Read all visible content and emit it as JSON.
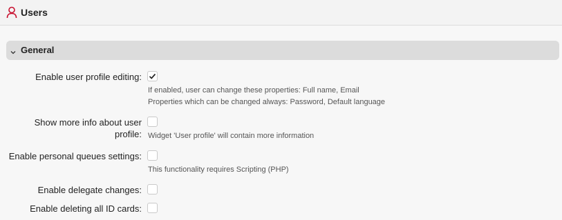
{
  "header": {
    "title": "Users",
    "icon": "user-icon",
    "icon_color": "#c8102e"
  },
  "section": {
    "title": "General",
    "icon": "chevron-down-icon"
  },
  "settings": [
    {
      "label": "Enable user profile editing:",
      "checked": true,
      "hints": [
        "If enabled, user can change these properties: Full name, Email",
        "Properties which can be changed always: Password, Default language"
      ]
    },
    {
      "label_line1": "Show more info about user",
      "label_line2": "profile:",
      "checked": false,
      "hints": [
        "Widget 'User profile' will contain more information"
      ]
    },
    {
      "label": "Enable personal queues settings:",
      "checked": false,
      "hints": [
        "This functionality requires Scripting (PHP)"
      ]
    },
    {
      "label": "Enable delegate changes:",
      "checked": false,
      "hints": []
    },
    {
      "label": "Enable deleting all ID cards:",
      "checked": false,
      "hints": []
    }
  ]
}
